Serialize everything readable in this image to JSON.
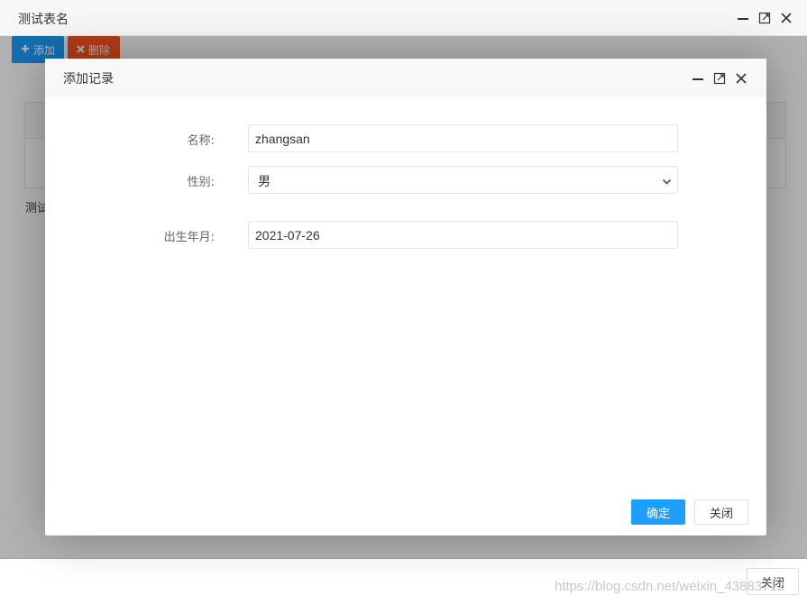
{
  "outer": {
    "title": "测试表名",
    "toolbar": {
      "add_label": "添加",
      "delete_label": "删除"
    },
    "under_text": "测试",
    "footer_close_label": "关闭"
  },
  "dialog": {
    "title": "添加记录",
    "fields": [
      {
        "label": "名称:",
        "value": "zhangsan"
      },
      {
        "label": "性别:",
        "value": "男"
      },
      {
        "label": "出生年月:",
        "value": "2021-07-26"
      }
    ],
    "confirm_label": "确定",
    "close_label": "关闭"
  },
  "watermark": "https://blog.csdn.net/weixin_43883712",
  "colors": {
    "primary": "#1e9fff",
    "danger": "#ff5722"
  },
  "icons": [
    "minimize-icon",
    "maximize-icon",
    "close-icon",
    "plus-icon",
    "x-icon",
    "chevron-down-icon"
  ]
}
